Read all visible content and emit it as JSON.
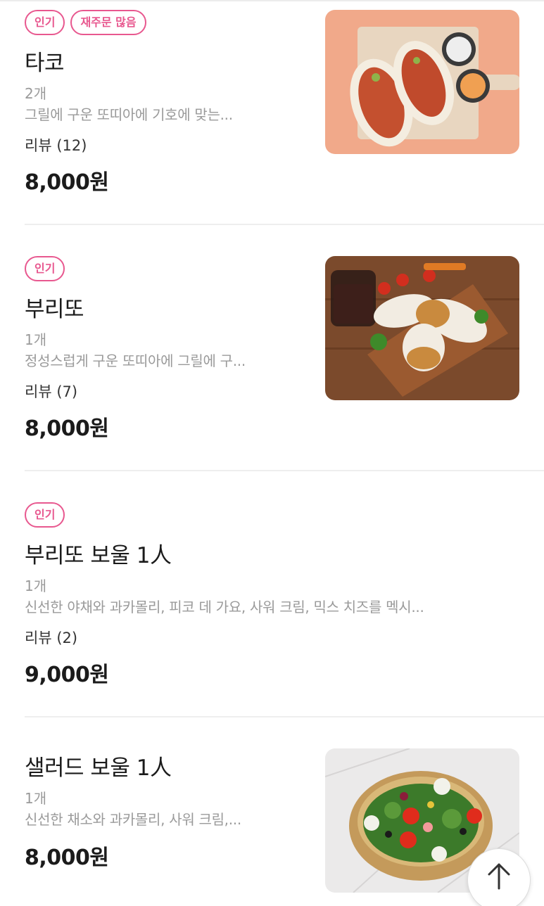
{
  "menu_items": [
    {
      "badges": [
        "인기",
        "재주문 많음"
      ],
      "name": "타코",
      "qty": "2개",
      "desc": "그릴에 구운 또띠아에 기호에 맞는...",
      "review": "리뷰 (12)",
      "price": "8,000원",
      "image": "taco-image"
    },
    {
      "badges": [
        "인기"
      ],
      "name": "부리또",
      "qty": "1개",
      "desc": "정성스럽게 구운 또띠아에 그릴에 구...",
      "review": "리뷰 (7)",
      "price": "8,000원",
      "image": "burrito-image"
    },
    {
      "badges": [
        "인기"
      ],
      "name": "부리또 보울 1人",
      "qty": "1개",
      "desc": "신선한 야채와 과카몰리, 피코 데 가요, 사워 크림, 믹스 치즈를 멕시...",
      "review": "리뷰 (2)",
      "price": "9,000원",
      "image": null
    },
    {
      "badges": [],
      "name": "샐러드 보울 1人",
      "qty": "1개",
      "desc": "신선한 채소와 과카몰리, 사워 크림,...",
      "review": "",
      "price": "8,000원",
      "image": "salad-bowl-image"
    }
  ],
  "scroll_top_icon": "arrow-up-icon",
  "colors": {
    "badge": "#e8588f",
    "muted": "#9a9a9a",
    "divider": "#eeeeee"
  }
}
